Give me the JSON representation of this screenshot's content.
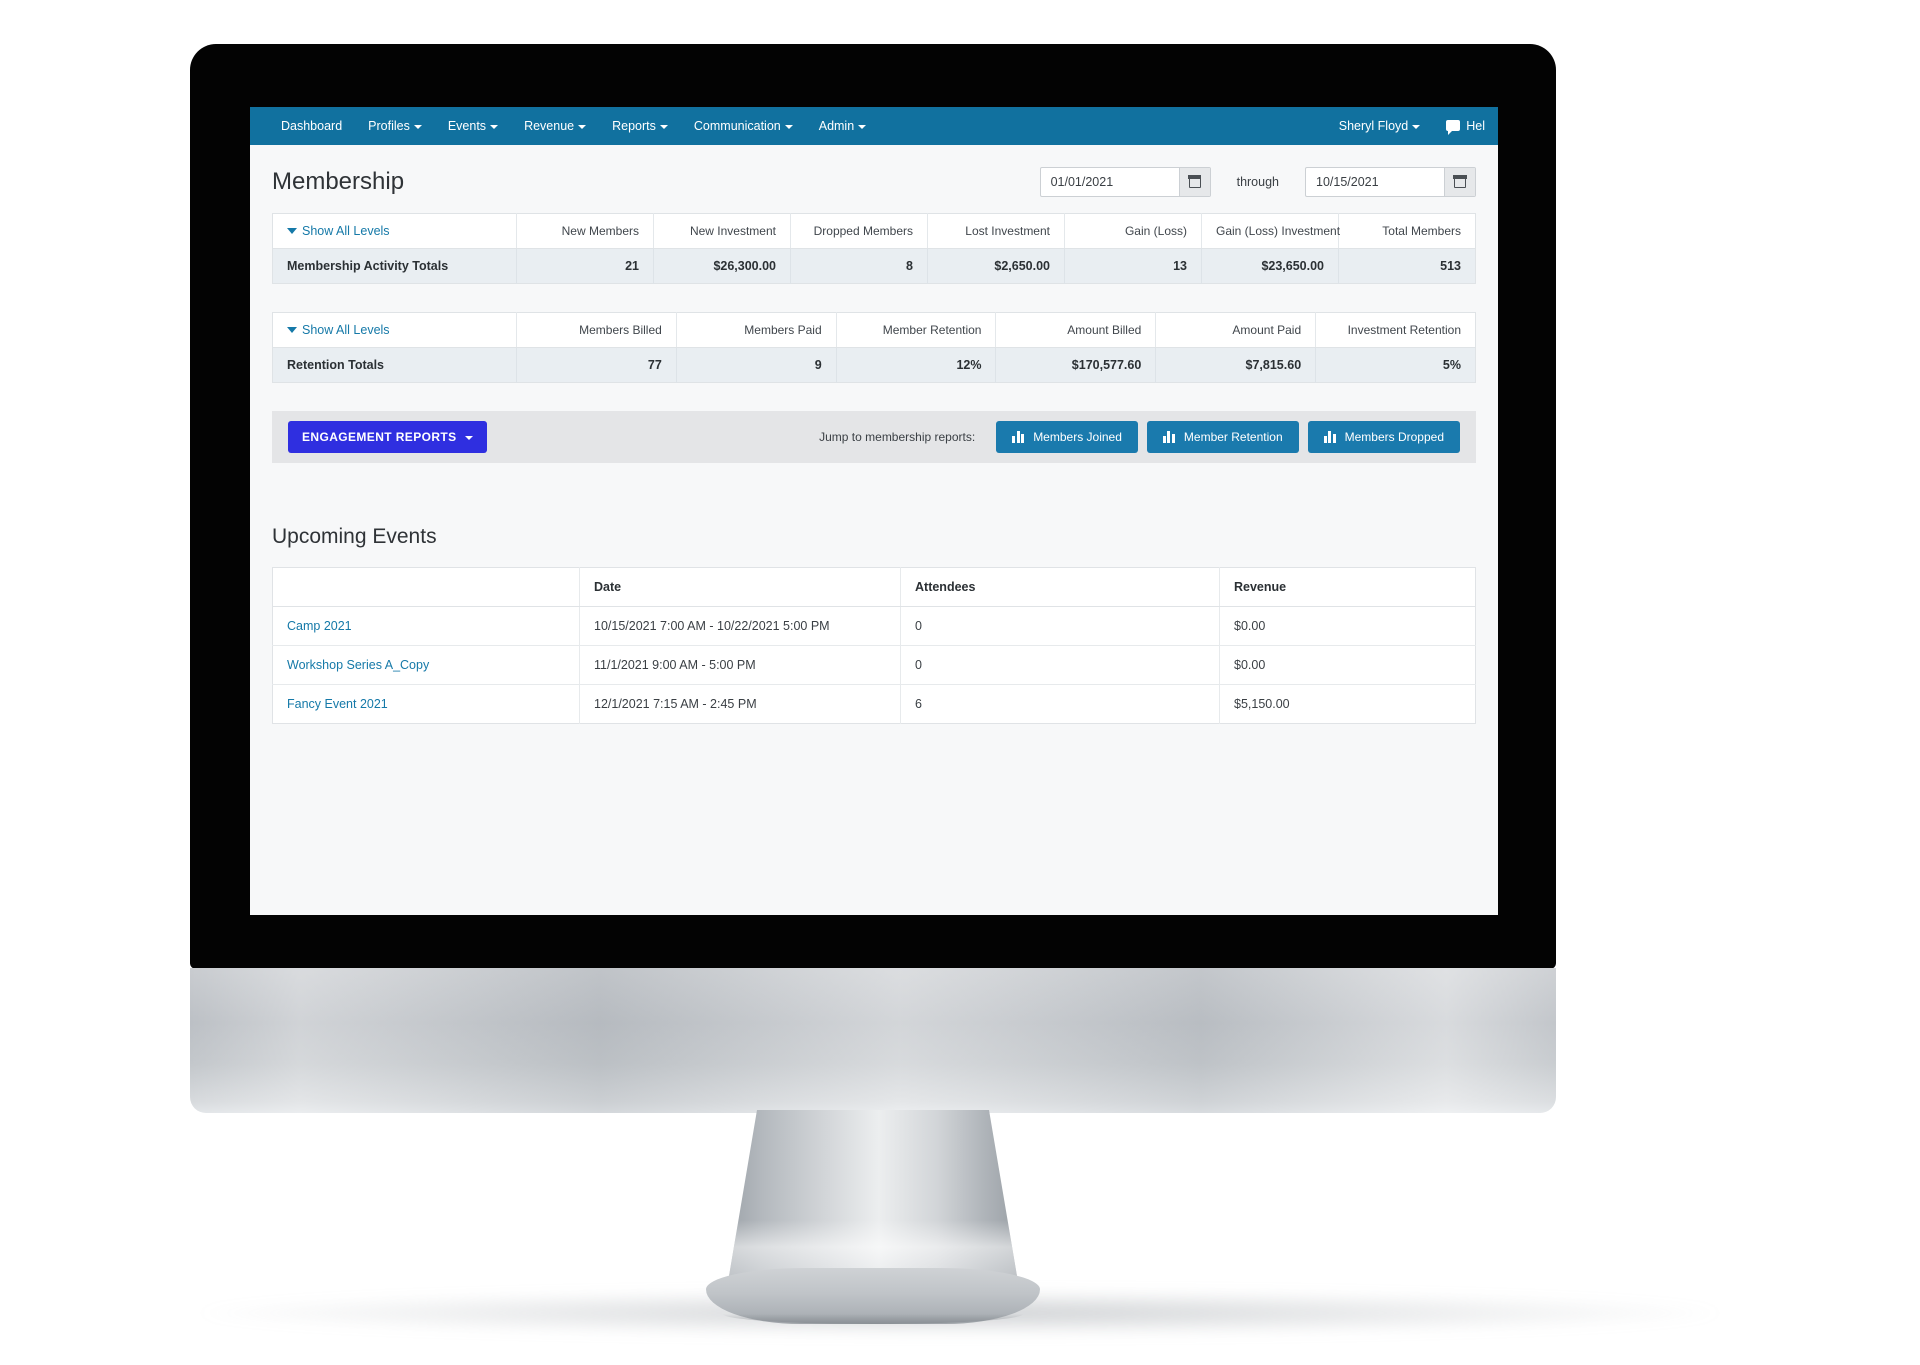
{
  "navbar": {
    "items": [
      {
        "label": "Dashboard",
        "caret": false
      },
      {
        "label": "Profiles",
        "caret": true
      },
      {
        "label": "Events",
        "caret": true
      },
      {
        "label": "Revenue",
        "caret": true
      },
      {
        "label": "Reports",
        "caret": true
      },
      {
        "label": "Communication",
        "caret": true
      },
      {
        "label": "Admin",
        "caret": true
      }
    ],
    "user": "Sheryl Floyd",
    "help": "Hel",
    "background_color": "#11719f"
  },
  "header": {
    "title": "Membership",
    "date_from": "01/01/2021",
    "date_from_placeholder": "mm/dd/yyyy",
    "through_label": "through",
    "date_to": "10/15/2021",
    "date_to_placeholder": "mm/dd/yyyy"
  },
  "activity_table": {
    "show_all_levels": "Show All Levels",
    "columns": [
      "New Members",
      "New Investment",
      "Dropped Members",
      "Lost Investment",
      "Gain (Loss)",
      "Gain (Loss) Investment",
      "Total Members"
    ],
    "row_label": "Membership Activity Totals",
    "values": [
      "21",
      "$26,300.00",
      "8",
      "$2,650.00",
      "13",
      "$23,650.00",
      "513"
    ]
  },
  "retention_table": {
    "show_all_levels": "Show All Levels",
    "columns": [
      "Members Billed",
      "Members Paid",
      "Member Retention",
      "Amount Billed",
      "Amount Paid",
      "Investment Retention"
    ],
    "row_label": "Retention Totals",
    "values": [
      "77",
      "9",
      "12%",
      "$170,577.60",
      "$7,815.60",
      "5%"
    ]
  },
  "report_bar": {
    "engagement_label": "ENGAGEMENT REPORTS",
    "engagement_color": "#2f2fe0",
    "jump_label": "Jump to membership reports:",
    "buttons": [
      {
        "label": "Members Joined"
      },
      {
        "label": "Member Retention"
      },
      {
        "label": "Members Dropped"
      }
    ],
    "button_color": "#1a7aad"
  },
  "events": {
    "title": "Upcoming Events",
    "columns": [
      "",
      "Date",
      "Attendees",
      "Revenue"
    ],
    "rows": [
      {
        "name": "Camp 2021",
        "date": "10/15/2021 7:00 AM - 10/22/2021 5:00 PM",
        "attendees": "0",
        "revenue": "$0.00"
      },
      {
        "name": "Workshop Series A_Copy",
        "date": "11/1/2021 9:00 AM - 5:00 PM",
        "attendees": "0",
        "revenue": "$0.00"
      },
      {
        "name": "Fancy Event 2021",
        "date": "12/1/2021 7:15 AM - 2:45 PM",
        "attendees": "6",
        "revenue": "$5,150.00"
      }
    ]
  }
}
